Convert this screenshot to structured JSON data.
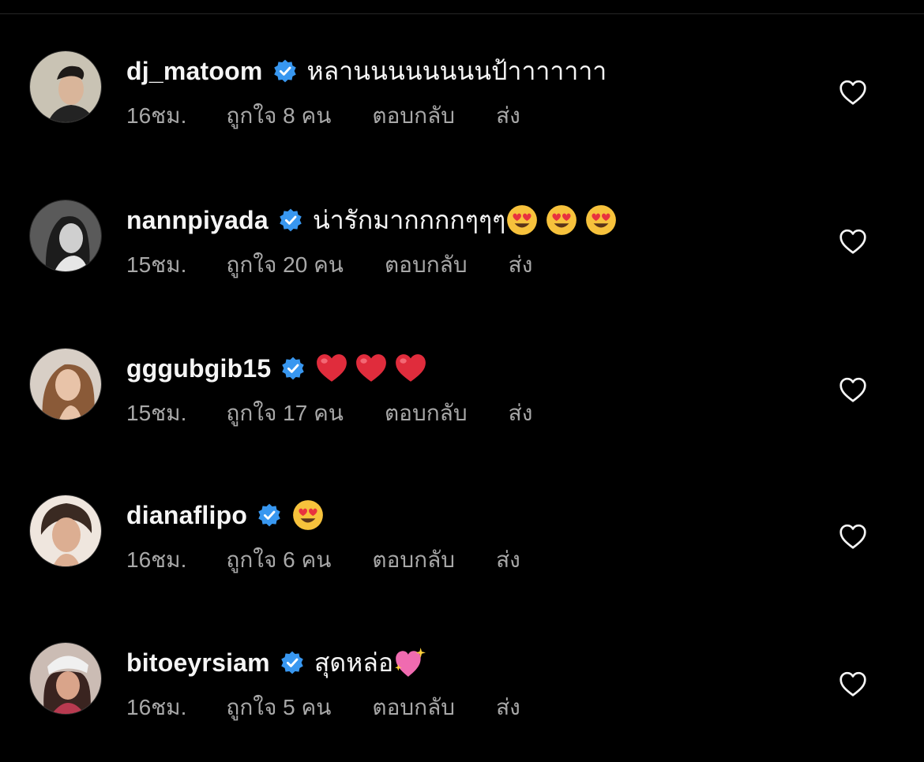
{
  "colors": {
    "background": "#000000",
    "primary_text": "#f5f5f5",
    "secondary_text": "#a8a8a8",
    "verified_badge": "#3897f0"
  },
  "comments": [
    {
      "username": "dj_matoom",
      "text": "หลานนนนนนนนป้าาาาาาา",
      "emojis": [],
      "time": "16ชม.",
      "likes": "ถูกใจ 8 คน",
      "reply": "ตอบกลับ",
      "send": "ส่ง"
    },
    {
      "username": "nannpiyada",
      "text": "น่ารักมากกกกๆๆๆ",
      "emojis": [
        "heart-eyes-emoji",
        "heart-eyes-emoji",
        "heart-eyes-emoji"
      ],
      "time": "15ชม.",
      "likes": "ถูกใจ 20 คน",
      "reply": "ตอบกลับ",
      "send": "ส่ง"
    },
    {
      "username": "gggubgib15",
      "text": "",
      "emojis": [
        "red-heart-emoji",
        "red-heart-emoji",
        "red-heart-emoji"
      ],
      "time": "15ชม.",
      "likes": "ถูกใจ 17 คน",
      "reply": "ตอบกลับ",
      "send": "ส่ง"
    },
    {
      "username": "dianaflipo",
      "text": "",
      "emojis": [
        "heart-eyes-emoji"
      ],
      "time": "16ชม.",
      "likes": "ถูกใจ 6 คน",
      "reply": "ตอบกลับ",
      "send": "ส่ง"
    },
    {
      "username": "bitoeyrsiam",
      "text": "สุดหล่อ",
      "emojis": [
        "sparkling-heart-emoji"
      ],
      "time": "16ชม.",
      "likes": "ถูกใจ 5 คน",
      "reply": "ตอบกลับ",
      "send": "ส่ง"
    }
  ]
}
